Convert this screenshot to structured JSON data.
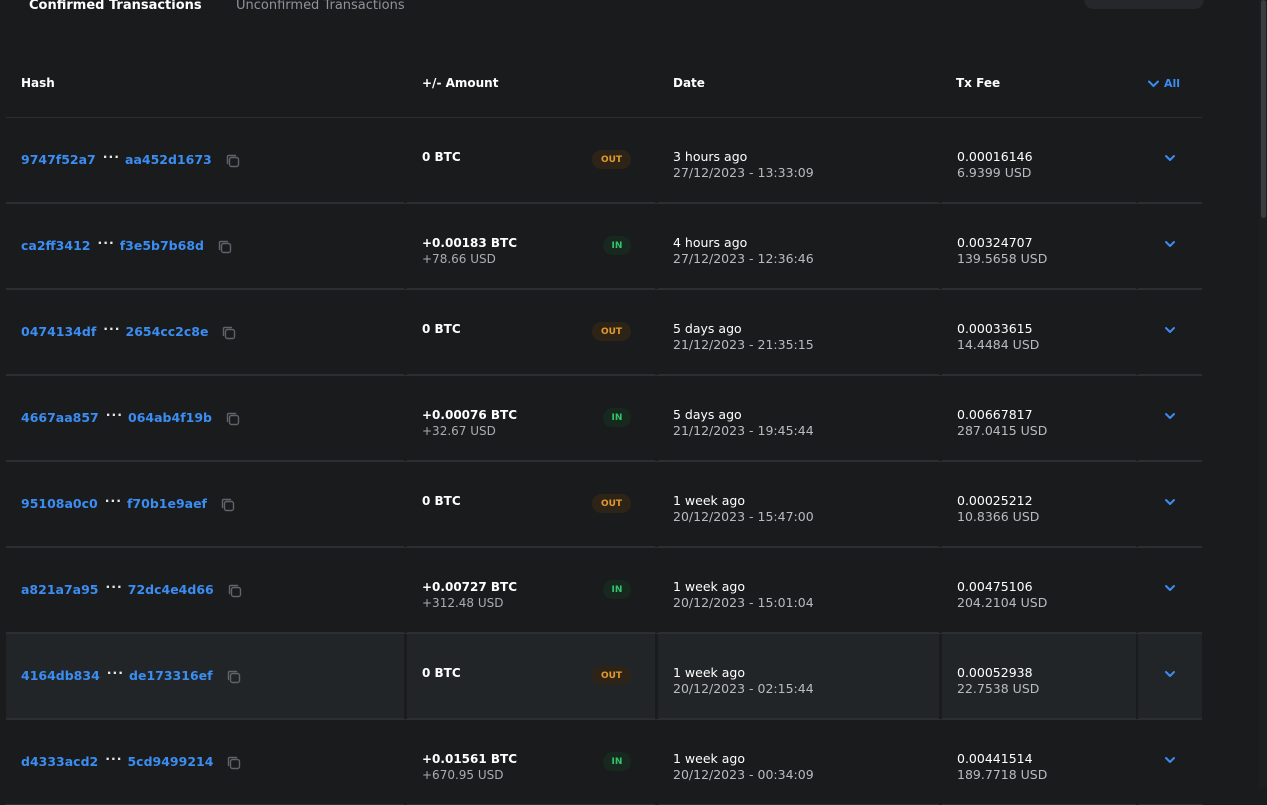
{
  "tabs": {
    "confirmed": "Confirmed Transactions",
    "unconfirmed": "Unconfirmed Transactions"
  },
  "headers": {
    "hash": "Hash",
    "amount": "+/- Amount",
    "date": "Date",
    "fee": "Tx Fee",
    "filter": "All"
  },
  "colors": {
    "link": "#3b8df2",
    "out": "#e39a2b",
    "in": "#35c46b",
    "background": "#1a1b1d"
  },
  "rows": [
    {
      "hash_start": "9747f52a7",
      "hash_end": "aa452d1673",
      "amount": "0 BTC",
      "amount_usd": "",
      "direction": "OUT",
      "date_relative": "3 hours ago",
      "date_full": "27/12/2023 - 13:33:09",
      "fee": "0.00016146",
      "fee_usd": "6.9399 USD"
    },
    {
      "hash_start": "ca2ff3412",
      "hash_end": "f3e5b7b68d",
      "amount": "+0.00183 BTC",
      "amount_usd": "+78.66 USD",
      "direction": "IN",
      "date_relative": "4 hours ago",
      "date_full": "27/12/2023 - 12:36:46",
      "fee": "0.00324707",
      "fee_usd": "139.5658 USD"
    },
    {
      "hash_start": "0474134df",
      "hash_end": "2654cc2c8e",
      "amount": "0 BTC",
      "amount_usd": "",
      "direction": "OUT",
      "date_relative": "5 days ago",
      "date_full": "21/12/2023 - 21:35:15",
      "fee": "0.00033615",
      "fee_usd": "14.4484 USD"
    },
    {
      "hash_start": "4667aa857",
      "hash_end": "064ab4f19b",
      "amount": "+0.00076 BTC",
      "amount_usd": "+32.67 USD",
      "direction": "IN",
      "date_relative": "5 days ago",
      "date_full": "21/12/2023 - 19:45:44",
      "fee": "0.00667817",
      "fee_usd": "287.0415 USD"
    },
    {
      "hash_start": "95108a0c0",
      "hash_end": "f70b1e9aef",
      "amount": "0 BTC",
      "amount_usd": "",
      "direction": "OUT",
      "date_relative": "1 week ago",
      "date_full": "20/12/2023 - 15:47:00",
      "fee": "0.00025212",
      "fee_usd": "10.8366 USD"
    },
    {
      "hash_start": "a821a7a95",
      "hash_end": "72dc4e4d66",
      "amount": "+0.00727 BTC",
      "amount_usd": "+312.48 USD",
      "direction": "IN",
      "date_relative": "1 week ago",
      "date_full": "20/12/2023 - 15:01:04",
      "fee": "0.00475106",
      "fee_usd": "204.2104 USD"
    },
    {
      "hash_start": "4164db834",
      "hash_end": "de173316ef",
      "amount": "0 BTC",
      "amount_usd": "",
      "direction": "OUT",
      "date_relative": "1 week ago",
      "date_full": "20/12/2023 - 02:15:44",
      "fee": "0.00052938",
      "fee_usd": "22.7538 USD"
    },
    {
      "hash_start": "d4333acd2",
      "hash_end": "5cd9499214",
      "amount": "+0.01561 BTC",
      "amount_usd": "+670.95 USD",
      "direction": "IN",
      "date_relative": "1 week ago",
      "date_full": "20/12/2023 - 00:34:09",
      "fee": "0.00441514",
      "fee_usd": "189.7718 USD"
    }
  ]
}
